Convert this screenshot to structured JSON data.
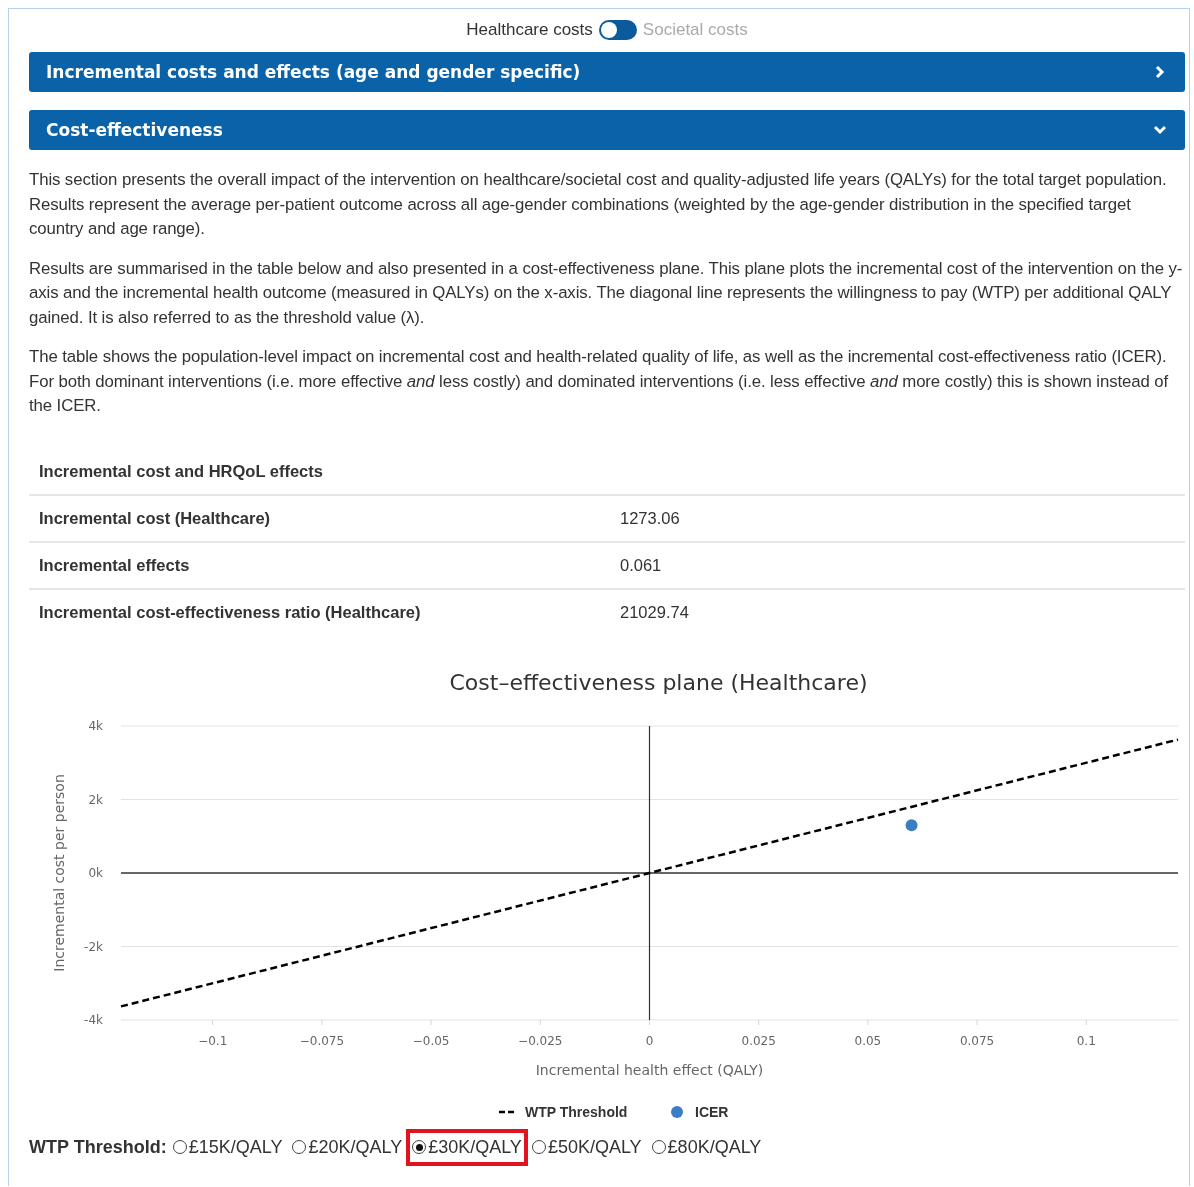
{
  "cost_toggle": {
    "left_label": "Healthcare costs",
    "right_label": "Societal costs",
    "on": false
  },
  "panels": [
    {
      "title": "Incremental costs and effects (age and gender specific)",
      "expanded": false
    },
    {
      "title": "Cost-effectiveness",
      "expanded": true
    }
  ],
  "paragraphs": [
    "This section presents the overall impact of the intervention on healthcare/societal cost and quality-adjusted life years (QALYs) for the total target population. Results represent the average per-patient outcome across all age-gender combinations (weighted by the age-gender distribution in the specified target country and age range).",
    "Results are summarised in the table below and also presented in a cost-effectiveness plane. This plane plots the incremental cost of the intervention on the y-axis and the incremental health outcome (measured in QALYs) on the x-axis. The diagonal line represents the willingness to pay (WTP) per additional QALY gained. It is also referred to as the threshold value (λ).",
    "The table shows the population-level impact on incremental cost and health-related quality of life, as well as the incremental cost-effectiveness ratio (ICER). For both dominant interventions (i.e. more effective *and* less costly) and dominated interventions (i.e. less effective *and* more costly) this is shown instead of the ICER."
  ],
  "table": {
    "title": "Incremental cost and HRQoL effects",
    "rows": [
      {
        "label": "Incremental cost (Healthcare)",
        "value": "1273.06"
      },
      {
        "label": "Incremental effects",
        "value": "0.061"
      },
      {
        "label": "Incremental cost-effectiveness ratio (Healthcare)",
        "value": "21029.74"
      }
    ]
  },
  "chart_data": {
    "type": "scatter",
    "title": "Cost–effectiveness plane (Healthcare)",
    "xlabel": "Incremental health effect (QALY)",
    "ylabel": "Incremental cost per person",
    "xlim": [
      -0.121,
      0.121
    ],
    "ylim": [
      -4000,
      4000
    ],
    "xticks": [
      -0.1,
      -0.075,
      -0.05,
      -0.025,
      0,
      0.025,
      0.05,
      0.075,
      0.1
    ],
    "yticks": [
      {
        "value": 4000,
        "label": "4k"
      },
      {
        "value": 2000,
        "label": "2k"
      },
      {
        "value": 0,
        "label": "0k"
      },
      {
        "value": -2000,
        "label": "-2k"
      },
      {
        "value": -4000,
        "label": "-4k"
      }
    ],
    "legend": true,
    "series": [
      {
        "name": "WTP Threshold",
        "color": "#000000",
        "type": "line",
        "line_style": "dashed",
        "x": [
          -0.121,
          0.121
        ],
        "values": [
          -3630,
          3630
        ]
      },
      {
        "name": "ICER",
        "color": "#3a7fc4",
        "type": "scatter",
        "x": [
          0.06
        ],
        "values": [
          1300
        ]
      }
    ]
  },
  "wtp": {
    "label": "WTP Threshold:",
    "options": [
      {
        "label": "£15K/QALY",
        "selected": false,
        "highlighted": false
      },
      {
        "label": "£20K/QALY",
        "selected": false,
        "highlighted": false
      },
      {
        "label": "£30K/QALY",
        "selected": true,
        "highlighted": true
      },
      {
        "label": "£50K/QALY",
        "selected": false,
        "highlighted": false
      },
      {
        "label": "£80K/QALY",
        "selected": false,
        "highlighted": false
      }
    ]
  }
}
